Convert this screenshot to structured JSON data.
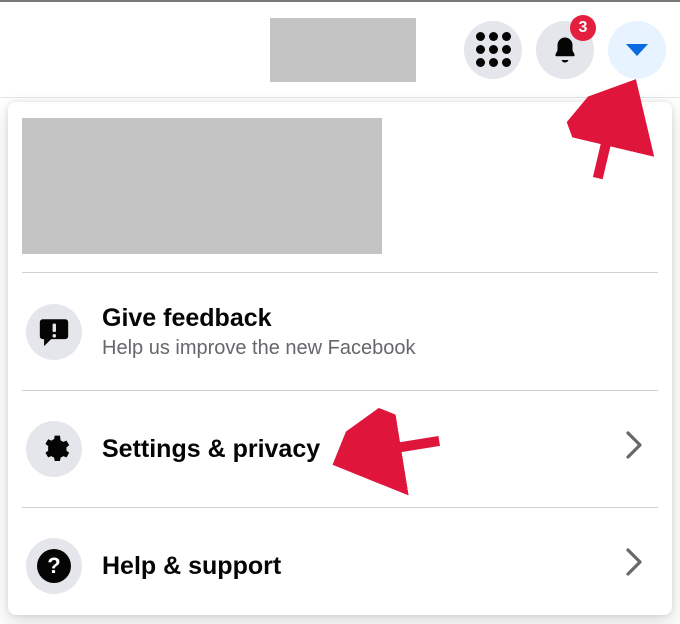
{
  "topbar": {
    "notification_count": "3"
  },
  "menu": {
    "feedback": {
      "title": "Give feedback",
      "subtitle": "Help us improve the new Facebook"
    },
    "settings": {
      "title": "Settings & privacy"
    },
    "help": {
      "title": "Help & support"
    }
  }
}
